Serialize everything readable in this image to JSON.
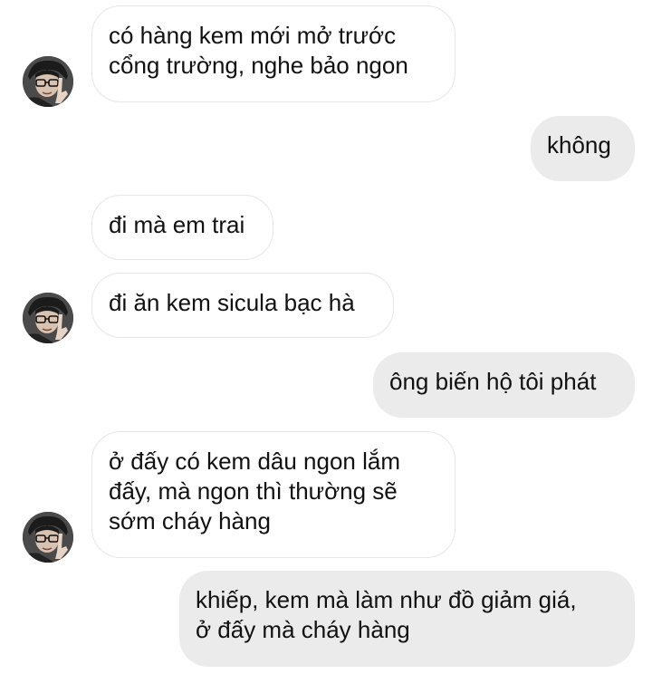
{
  "conversation": {
    "messages": [
      {
        "side": "incoming",
        "text": "có hàng kem mới mở trước\ncổng trường, nghe bảo ngon"
      },
      {
        "side": "outgoing",
        "text": "không"
      },
      {
        "side": "incoming",
        "text": "đi mà em trai"
      },
      {
        "side": "incoming",
        "text": "đi ăn kem sicula bạc hà"
      },
      {
        "side": "outgoing",
        "text": "ông biến hộ tôi phát"
      },
      {
        "side": "incoming",
        "text": "ở đấy có kem dâu ngon lắm\nđấy, mà ngon thì thường sẽ\nsớm cháy hàng"
      },
      {
        "side": "outgoing",
        "text": "khiếp, kem mà làm như đồ giảm giá,\nở đấy mà cháy hàng"
      }
    ]
  },
  "avatar": {
    "icon": "contact-avatar-photo"
  }
}
